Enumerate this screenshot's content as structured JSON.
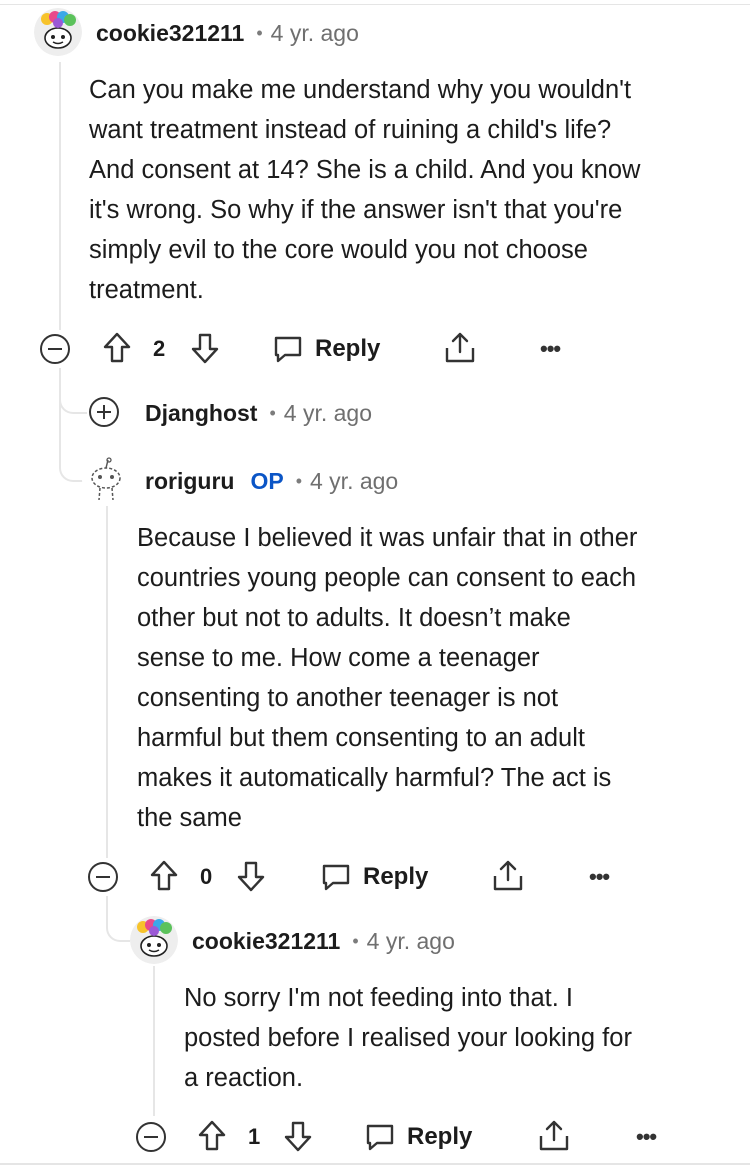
{
  "comments": [
    {
      "username": "cookie321211",
      "time": "4 yr. ago",
      "avatar_icon": "snoo-avatar-icon",
      "body": "Can you make me understand why you wouldn't\nwant treatment instead of ruining a child's life?\nAnd consent at 14? She is a child. And you know\nit's wrong. So why if the answer isn't that you're\nsimply evil to the core would you not choose\ntreatment.",
      "votes": "2",
      "reply_label": "Reply"
    },
    {
      "username": "Djanghost",
      "time": "4 yr. ago",
      "collapsed": true
    },
    {
      "username": "roriguru",
      "op_badge": "OP",
      "time": "4 yr. ago",
      "avatar_icon": "snoo-outline-avatar-icon",
      "body": "Because I believed it was unfair that in other\ncountries young people can consent to each\nother but not to adults. It doesn’t make\nsense to me. How come a teenager\nconsenting to another teenager is not\nharmful but them consenting to an adult\nmakes it automatically harmful? The act is\nthe same",
      "votes": "0",
      "reply_label": "Reply"
    },
    {
      "username": "cookie321211",
      "time": "4 yr. ago",
      "avatar_icon": "snoo-avatar-icon",
      "body": "No sorry I'm not feeding into that. I\nposted before I realised your looking for\na reaction.",
      "votes": "1",
      "reply_label": "Reply"
    }
  ],
  "separator": "•",
  "more_label": "•••",
  "colors": {
    "op_badge": "#0b55c6",
    "thread_line": "#e6e6e6",
    "text": "#1c1c1c",
    "meta": "#6f6f6f"
  }
}
